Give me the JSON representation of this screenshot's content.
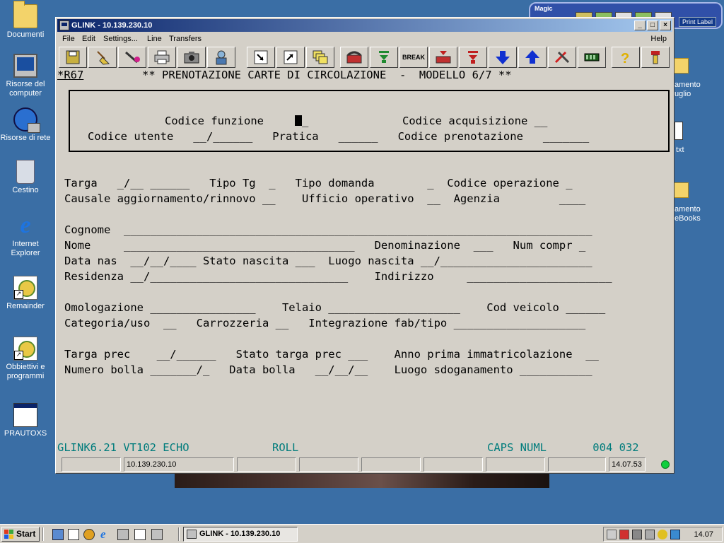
{
  "desktop": {
    "icons": [
      {
        "label": "Documenti"
      },
      {
        "label": "Risorse del computer"
      },
      {
        "label": "Risorse di rete"
      },
      {
        "label": "Cestino"
      },
      {
        "label": "Internet Explorer"
      },
      {
        "label": "Remainder"
      },
      {
        "label": "Obbiettivi e programmi"
      },
      {
        "label": "PRAUTOXS"
      }
    ],
    "right_partial": [
      {
        "label": "amento\nuglio"
      },
      {
        "label": "txt"
      },
      {
        "label": "amento\neBooks"
      }
    ]
  },
  "magic_widget": {
    "title": "Magic",
    "print_label": "Print Label"
  },
  "window": {
    "title": "GLINK - 10.139.230.10",
    "caption": {
      "minimize": "_",
      "maximize": "□",
      "close": "×"
    },
    "menu": [
      "File",
      "Edit",
      "Settings...",
      "Line",
      "Transfers"
    ],
    "help": "Help",
    "toolbar": [
      "disk-icon",
      "broom-icon",
      "tools-icon",
      "printer-icon",
      "camera-icon",
      "user-icon",
      "screen-in-icon",
      "screen-out-icon",
      "windows-icon",
      "phone-icon",
      "hangup-icon",
      "green-arrow-down-icon",
      "BREAK",
      "phone-red-icon",
      "red-arrow-down-icon",
      "blue-arrow-down-icon",
      "blue-arrow-up-icon",
      "pliers-icon",
      "chip-icon",
      "help-icon",
      "exit-icon"
    ]
  },
  "terminal": {
    "screen_id": "*R67",
    "header": "** PRENOTAZIONE CARTE DI CIRCOLAZIONE  -  MODELLO 6/7 **",
    "lines": {
      "l1": "Codice funzione",
      "l1b": "Codice acquisizione __",
      "l2": "Codice utente   __/______   Pratica   ______   Codice prenotazione   _______",
      "l3": "Targa   _/__ ______   Tipo Tg  _   Tipo domanda        _  Codice operazione _",
      "l4": "Causale aggiornamento/rinnovo __    Ufficio operativo  __  Agenzia         ____",
      "l5": "Cognome  _______________________________________________________________________",
      "l6": "Nome     ___________________________________   Denominazione  ___   Num compr _",
      "l7": "Data nas  __/__/____ Stato nascita ___  Luogo nascita __/_______________________",
      "l8": "Residenza __/______________________________    Indirizzo     ______________________",
      "l9": "Omologazione ________________    Telaio ____________________    Cod veicolo ______",
      "l10": "Categoria/uso  __   Carrozzeria __   Integrazione fab/tipo ____________________",
      "l11": "Targa prec    __/______   Stato targa prec ___    Anno prima immatricolazione  __",
      "l12": "Numero bolla _______/_   Data bolla   __/__/__    Luogo sdoganamento ___________"
    },
    "status_left": "GLINK6.21 VT102 ECHO",
    "status_mid": "ROLL",
    "status_right": "CAPS NUML       004 032"
  },
  "statusbar": {
    "host": "10.139.230.10",
    "time": "14.07.53"
  },
  "taskbar": {
    "start": "Start",
    "task": "GLINK - 10.139.230.10",
    "clock": "14.07"
  }
}
